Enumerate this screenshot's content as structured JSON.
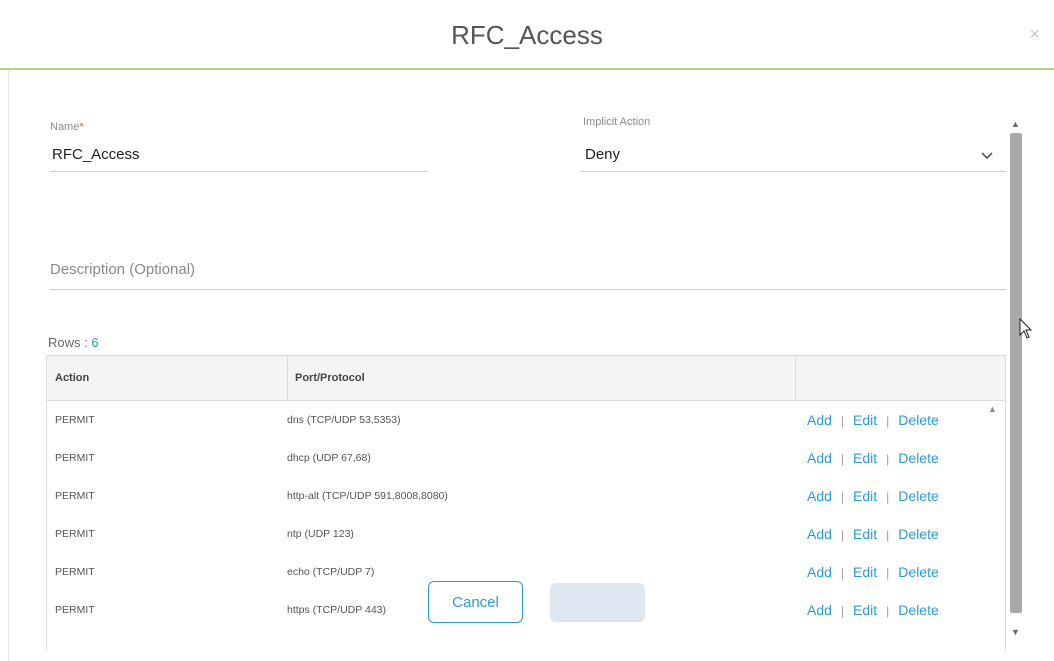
{
  "dialog": {
    "title": "RFC_Access",
    "close_glyph": "×"
  },
  "form": {
    "name_label": "Name",
    "name_required_mark": "*",
    "name_value": "RFC_Access",
    "implicit_action_label": "Implicit Action",
    "implicit_action_value": "Deny",
    "description_placeholder": "Description (Optional)"
  },
  "rows_summary": {
    "label": "Rows : ",
    "count": "6"
  },
  "table": {
    "columns": [
      "Action",
      "Port/Protocol",
      ""
    ],
    "rows": [
      {
        "action": "PERMIT",
        "port_protocol": "dns (TCP/UDP 53,5353)"
      },
      {
        "action": "PERMIT",
        "port_protocol": "dhcp (UDP 67,68)"
      },
      {
        "action": "PERMIT",
        "port_protocol": "http-alt (TCP/UDP 591,8008,8080)"
      },
      {
        "action": "PERMIT",
        "port_protocol": "ntp (UDP 123)"
      },
      {
        "action": "PERMIT",
        "port_protocol": "echo (TCP/UDP 7)"
      },
      {
        "action": "PERMIT",
        "port_protocol": "https (TCP/UDP 443)"
      }
    ],
    "row_links": {
      "add": "Add",
      "edit": "Edit",
      "delete": "Delete",
      "separator": "|"
    }
  },
  "buttons": {
    "cancel": "Cancel",
    "save": ""
  },
  "icons": {
    "close": "close-icon",
    "dropdown": "chevron-down-icon",
    "scroll_up": "scroll-up-arrow-icon",
    "scroll_down": "scroll-down-arrow-icon",
    "cursor": "mouse-pointer-icon"
  },
  "colors": {
    "accent": "#2b9ad6",
    "header_rule": "#b4d57a",
    "required": "#d9534f",
    "save_disabled": "#dde7f1"
  }
}
